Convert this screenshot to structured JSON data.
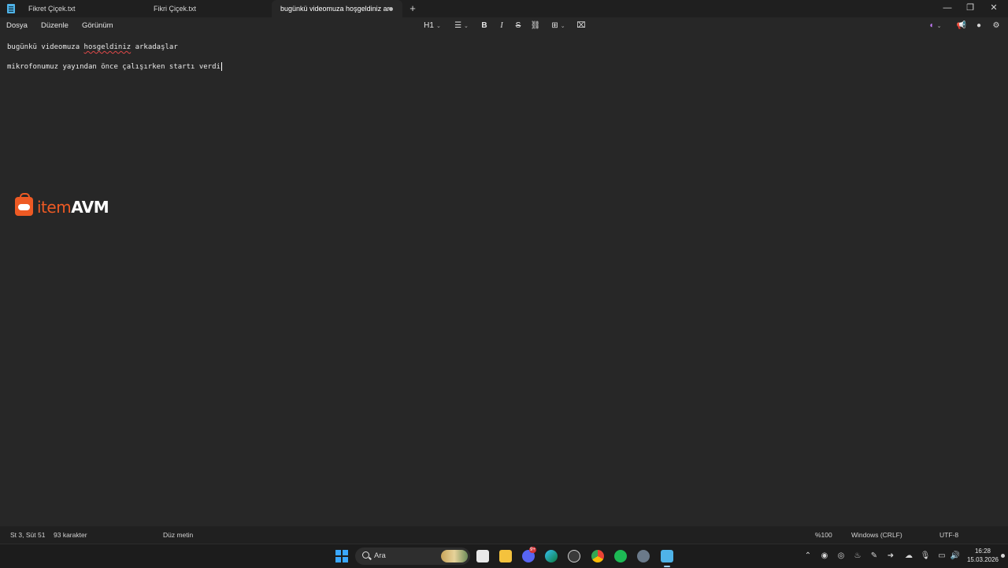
{
  "window": {
    "tabs": [
      {
        "label": "Fikret Çiçek.txt",
        "active": false
      },
      {
        "label": "Fikri Çiçek.txt",
        "active": false
      },
      {
        "label": "bugünkü videomuza hoşgeldiniz ar",
        "active": true,
        "unsaved": true
      }
    ],
    "new_tab_label": "+",
    "controls": {
      "minimize": "—",
      "maximize": "❐",
      "close": "✕"
    }
  },
  "menu": {
    "items": [
      "Dosya",
      "Düzenle",
      "Görünüm"
    ]
  },
  "toolbar": {
    "heading": "H1",
    "bold": "B",
    "italic": "I",
    "strikethrough": "S",
    "link_icon": "link-icon",
    "table_icon": "table-icon",
    "list_icon": "list-icon",
    "clear_format_icon": "clear-format-icon"
  },
  "editor": {
    "line1": {
      "before": "bugünkü videomuza ",
      "misspelled": "hosgeldiniz",
      "after": " arkadaşlar"
    },
    "line3": "mikrofonumuz yayından önce çalışırken startı verdi"
  },
  "logo": {
    "part1": "item",
    "part2": "AVM",
    "color": "#ee5a24"
  },
  "status": {
    "position": "St 3, Süt 51",
    "characters": "93 karakter",
    "format": "Düz metin",
    "zoom": "%100",
    "line_ending": "Windows (CRLF)",
    "encoding": "UTF-8"
  },
  "taskbar": {
    "search_label": "Ara",
    "discord_badge": "9+",
    "time": "16:28",
    "date": "15.03.2026"
  }
}
